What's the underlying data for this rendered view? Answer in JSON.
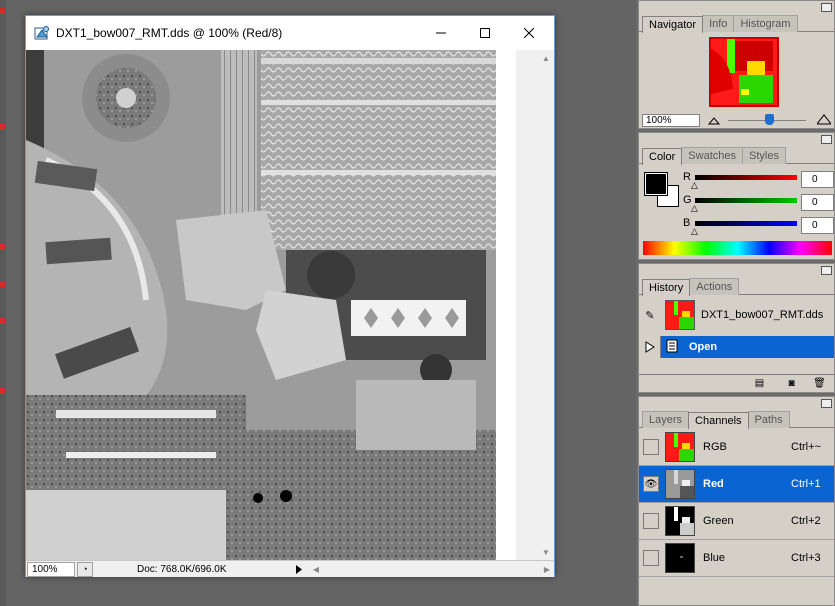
{
  "document": {
    "title": "DXT1_bow007_RMT.dds @ 100% (Red/8)",
    "zoom": "100%",
    "doc_info": "Doc: 768.0K/696.0K"
  },
  "navigator": {
    "tabs": [
      "Navigator",
      "Info",
      "Histogram"
    ],
    "active_tab": "Navigator",
    "zoom": "100%",
    "zoom_level": 0.55
  },
  "color": {
    "tabs": [
      "Color",
      "Swatches",
      "Styles"
    ],
    "active_tab": "Color",
    "foreground": "#000000",
    "background": "#ffffff",
    "channels": [
      {
        "label": "R",
        "value": "0",
        "color": "#e00000"
      },
      {
        "label": "G",
        "value": "0",
        "color": "#00b000"
      },
      {
        "label": "B",
        "value": "0",
        "color": "#0000e0"
      }
    ]
  },
  "history": {
    "tabs": [
      "History",
      "Actions"
    ],
    "active_tab": "History",
    "snapshot_label": "DXT1_bow007_RMT.dds",
    "items": [
      {
        "label": "Open",
        "selected": true
      }
    ]
  },
  "channels": {
    "tabs": [
      "Layers",
      "Channels",
      "Paths"
    ],
    "active_tab": "Channels",
    "rows": [
      {
        "name": "RGB",
        "shortcut": "Ctrl+~",
        "visible": false,
        "selected": false
      },
      {
        "name": "Red",
        "shortcut": "Ctrl+1",
        "visible": true,
        "selected": true
      },
      {
        "name": "Green",
        "shortcut": "Ctrl+2",
        "visible": false,
        "selected": false
      },
      {
        "name": "Blue",
        "shortcut": "Ctrl+3",
        "visible": false,
        "selected": false
      }
    ]
  },
  "colors": {
    "selection": "#0a64d2",
    "panel_bg": "#d4d0c8",
    "workspace": "#646464"
  }
}
